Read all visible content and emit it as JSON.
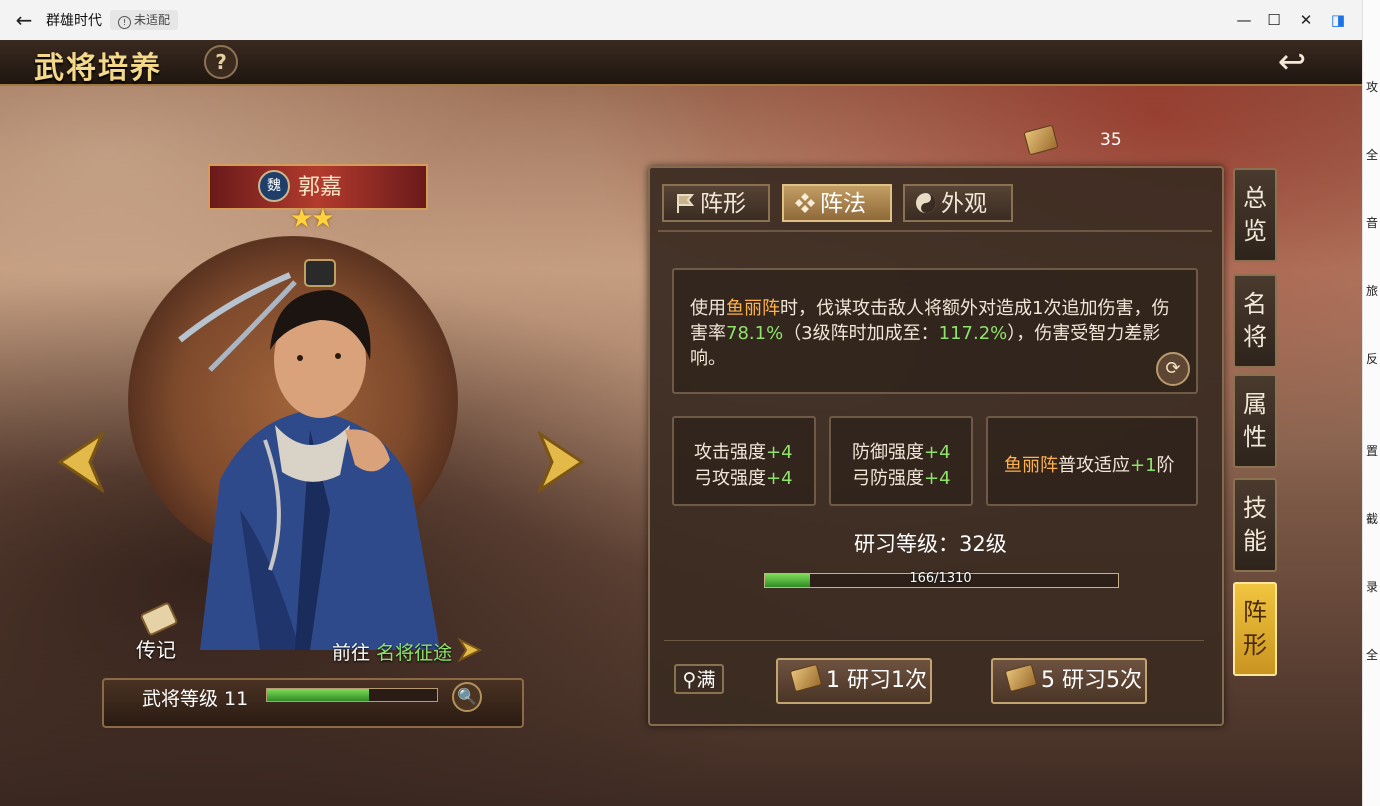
{
  "window": {
    "back": "←",
    "title": "群雄时代",
    "badge": "未适配",
    "controls": {
      "minimize": "—",
      "maximize": "☐",
      "close": "✕",
      "sidebar": "◨"
    }
  },
  "header": {
    "title": "武将培养",
    "help": "?",
    "back_icon": "return-arrow-icon"
  },
  "currency": {
    "icon": "scroll-icon",
    "value": "35"
  },
  "hero": {
    "faction": "魏",
    "name": "郭嘉",
    "stars": "★★",
    "bio_label": "传记",
    "goto_prefix": "前往",
    "goto_target": "名将征途",
    "level_label": "武将等级 11",
    "level_progress": 0.6,
    "zoom_icon": "🔍"
  },
  "panel": {
    "tabs": [
      {
        "label": "阵形",
        "icon": "flag-icon",
        "active": false
      },
      {
        "label": "阵法",
        "icon": "diamond-cluster-icon",
        "active": true
      },
      {
        "label": "外观",
        "icon": "yin-yang-icon",
        "active": false
      }
    ],
    "description": {
      "p1": "使用",
      "formation": "鱼丽阵",
      "p2": "时，伐谋攻击敌人将额外对造成1次追加伤害，伤害率",
      "rate": "78.1%",
      "p3": "（3级阵时加成至：",
      "rate_max": "117.2%",
      "p4": "），伤害受智力差影响。"
    },
    "bonuses": {
      "attack": {
        "l1": "攻击强度",
        "v1": "+4",
        "l2": "弓攻强度",
        "v2": "+4"
      },
      "defense": {
        "l1": "防御强度",
        "v1": "+4",
        "l2": "弓防强度",
        "v2": "+4"
      },
      "adapt": {
        "formation": "鱼丽阵",
        "text": "普攻适应",
        "value": "+1",
        "unit": "阶"
      }
    },
    "research": {
      "title": "研习等级：32级",
      "current": 166,
      "max": 1310,
      "text": "166/1310"
    },
    "buttons": {
      "max": "满",
      "study1_count": "1",
      "study1": "研习1次",
      "study5_count": "5",
      "study5": "研习5次"
    }
  },
  "side_tabs": [
    {
      "label": "总览",
      "active": false
    },
    {
      "label": "名将",
      "active": false
    },
    {
      "label": "属性",
      "active": false
    },
    {
      "label": "技能",
      "active": false
    },
    {
      "label": "阵形",
      "active": true
    }
  ],
  "right_strip": [
    "攻",
    "全",
    "音",
    "旅",
    "反",
    "置",
    "截",
    "录",
    "全"
  ]
}
